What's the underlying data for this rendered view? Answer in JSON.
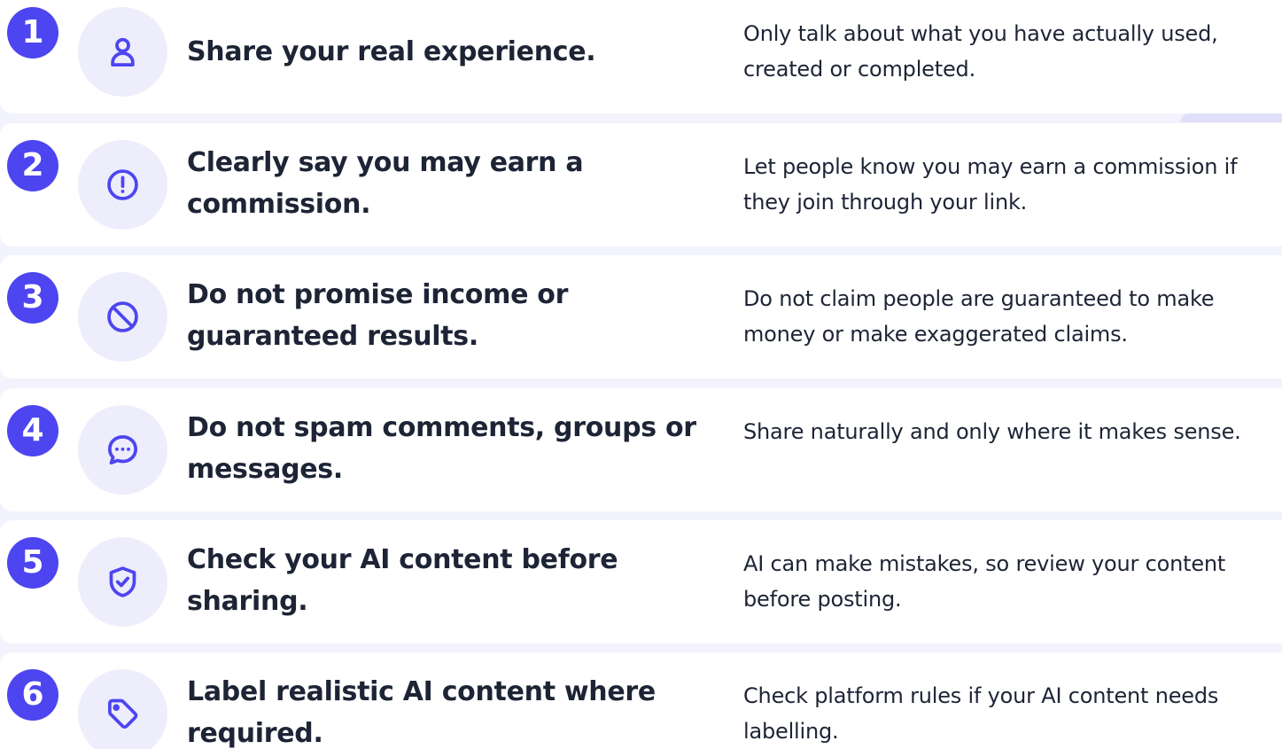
{
  "rules": [
    {
      "number": "1",
      "icon": "user-icon",
      "title": "Share your real experience.",
      "description": "Only talk about what you have actually used, created or completed."
    },
    {
      "number": "2",
      "icon": "alert-circle-icon",
      "title": "Clearly say you may earn a commission.",
      "description": "Let people know you may earn a commission if they join through your link."
    },
    {
      "number": "3",
      "icon": "ban-icon",
      "title": "Do not promise income or guaranteed results.",
      "description": "Do not claim people are guaranteed to make money or make exaggerated claims."
    },
    {
      "number": "4",
      "icon": "chat-bubble-icon",
      "title": "Do not spam comments, groups or messages.",
      "description": "Share naturally and only where it makes sense."
    },
    {
      "number": "5",
      "icon": "shield-check-icon",
      "title": "Check your AI content before sharing.",
      "description": "AI can make mistakes, so review your content before posting."
    },
    {
      "number": "6",
      "icon": "tag-icon",
      "title": "Label realistic AI content where required.",
      "description": "Check platform rules if your AI content needs labelling."
    }
  ],
  "colors": {
    "accent": "#4d45f0",
    "icon_bg": "#ededfc",
    "text": "#1d2435",
    "page_bg": "#f3f3fd"
  }
}
